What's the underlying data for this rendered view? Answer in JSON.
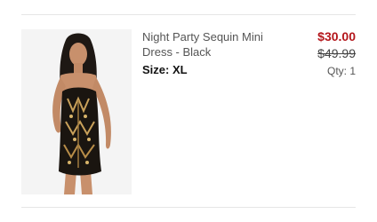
{
  "cart_item": {
    "name": "Night Party Sequin Mini Dress - Black",
    "size_label": "Size: XL",
    "sale_price": "$30.00",
    "original_price": "$49.99",
    "quantity_label": "Qty: 1",
    "image_icon": "product-photo-model-in-sequin-dress"
  },
  "colors": {
    "sale_price": "#b4161b",
    "divider": "#e6e6e6",
    "image_bg": "#f4f4f4"
  }
}
